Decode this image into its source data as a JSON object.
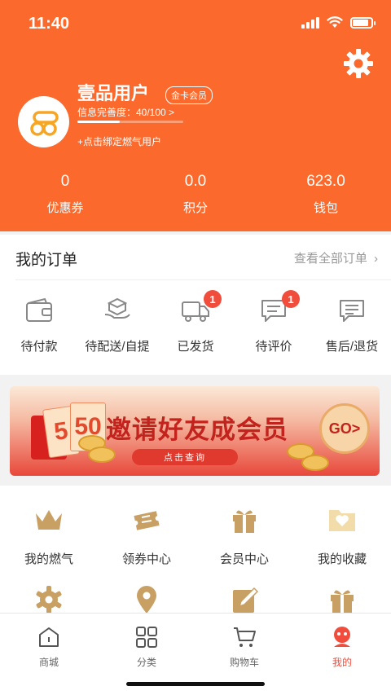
{
  "status_bar": {
    "time": "11:40",
    "battery_level": 0.85
  },
  "profile": {
    "username": "壹品用户",
    "vip_level": "金卡会员",
    "profile_progress_label": "信息完善度：40/100 >",
    "profile_progress": 0.4,
    "bind_gas_label": "+点击绑定燃气用户"
  },
  "stats": [
    {
      "value": "0",
      "label": "优惠券"
    },
    {
      "value": "0.0",
      "label": "积分"
    },
    {
      "value": "623.0",
      "label": "钱包"
    }
  ],
  "orders": {
    "title": "我的订单",
    "view_all": "查看全部订单",
    "items": [
      {
        "label": "待付款",
        "icon": "wallet-icon",
        "badge": ""
      },
      {
        "label": "待配送/自提",
        "icon": "package-hand-icon",
        "badge": ""
      },
      {
        "label": "已发货",
        "icon": "truck-icon",
        "badge": "1"
      },
      {
        "label": "待评价",
        "icon": "comment-icon",
        "badge": "1"
      },
      {
        "label": "售后/退货",
        "icon": "after-sales-icon",
        "badge": ""
      }
    ]
  },
  "banner": {
    "headline": "邀请好友成会员",
    "button": "点击查询",
    "go_label": "GO>",
    "card_digits": [
      "5",
      "50"
    ]
  },
  "services": [
    {
      "label": "我的燃气",
      "icon": "crown-icon"
    },
    {
      "label": "领券中心",
      "icon": "coupon-icon"
    },
    {
      "label": "会员中心",
      "icon": "gift-icon"
    },
    {
      "label": "我的收藏",
      "icon": "favorite-folder-icon"
    },
    {
      "label": "",
      "icon": "settings-icon"
    },
    {
      "label": "",
      "icon": "location-icon"
    },
    {
      "label": "",
      "icon": "edit-icon"
    },
    {
      "label": "",
      "icon": "gift-box-icon"
    }
  ],
  "tabbar": [
    {
      "label": "商城",
      "icon": "store-icon",
      "active": false
    },
    {
      "label": "分类",
      "icon": "category-icon",
      "active": false
    },
    {
      "label": "购物车",
      "icon": "cart-icon",
      "active": false
    },
    {
      "label": "我的",
      "icon": "profile-icon",
      "active": true
    }
  ],
  "colors": {
    "brand": "#fb6a2c",
    "accent_red": "#f04d3d",
    "gold": "#c9a063"
  }
}
